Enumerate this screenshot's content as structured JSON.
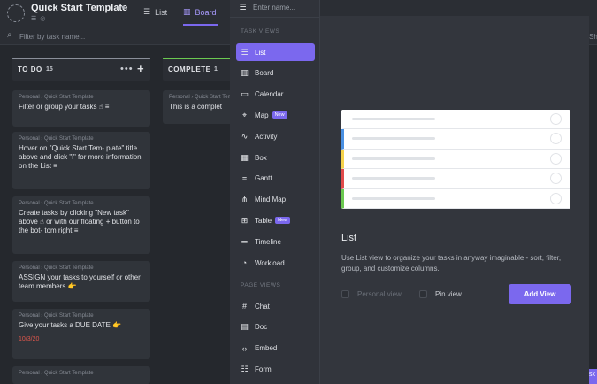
{
  "header": {
    "title": "Quick Start Template",
    "tabs": [
      {
        "label": "List"
      },
      {
        "label": "Board"
      }
    ]
  },
  "filter": {
    "placeholder": "Filter by task name..."
  },
  "columns": [
    {
      "name": "TO DO",
      "count": "15"
    },
    {
      "name": "COMPLETE",
      "count": "1"
    }
  ],
  "crumb": "Personal › Quick Start Template",
  "todo_cards": [
    {
      "text": "Filter or group your tasks ☝ ≡"
    },
    {
      "text": "Hover on \"Quick Start Tem- plate\" title above and click \"i\" for more information on the List ≡"
    },
    {
      "text": "Create tasks by clicking \"New task\" above ☝ or with our floating + button to the bot- tom right ≡"
    },
    {
      "text": "ASSIGN your tasks to yourself or other team members 👉"
    },
    {
      "text": "Give your tasks a DUE DATE 👉",
      "date": "10/3/20"
    },
    {
      "text": ""
    }
  ],
  "complete_cards": [
    {
      "text": "This is a complet"
    }
  ],
  "menu": {
    "search_placeholder": "Enter name...",
    "task_views_label": "TASK VIEWS",
    "page_views_label": "PAGE VIEWS",
    "task_views": [
      {
        "label": "List",
        "icon": "list-icon",
        "active": true
      },
      {
        "label": "Board",
        "icon": "board-icon"
      },
      {
        "label": "Calendar",
        "icon": "calendar-icon"
      },
      {
        "label": "Map",
        "icon": "map-pin-icon",
        "badge": "New"
      },
      {
        "label": "Activity",
        "icon": "activity-icon"
      },
      {
        "label": "Box",
        "icon": "box-icon"
      },
      {
        "label": "Gantt",
        "icon": "gantt-icon"
      },
      {
        "label": "Mind Map",
        "icon": "mind-map-icon"
      },
      {
        "label": "Table",
        "icon": "table-icon",
        "badge": "New"
      },
      {
        "label": "Timeline",
        "icon": "timeline-icon"
      },
      {
        "label": "Workload",
        "icon": "workload-icon"
      }
    ],
    "page_views": [
      {
        "label": "Chat",
        "icon": "chat-icon"
      },
      {
        "label": "Doc",
        "icon": "doc-icon"
      },
      {
        "label": "Embed",
        "icon": "embed-icon"
      },
      {
        "label": "Form",
        "icon": "form-icon"
      }
    ]
  },
  "preview": {
    "title": "List",
    "description": "Use List view to organize your tasks in anyway imaginable - sort, filter, group, and customize columns.",
    "personal_view": "Personal view",
    "pin_view": "Pin view",
    "add_button": "Add View",
    "row_colors": [
      "#ffffff",
      "#4a90e2",
      "#f5d24b",
      "#e24b4b",
      "#6bc950"
    ]
  },
  "colors": {
    "accent": "#7b68ee",
    "complete": "#6bc950",
    "due_date": "#e0574c"
  }
}
